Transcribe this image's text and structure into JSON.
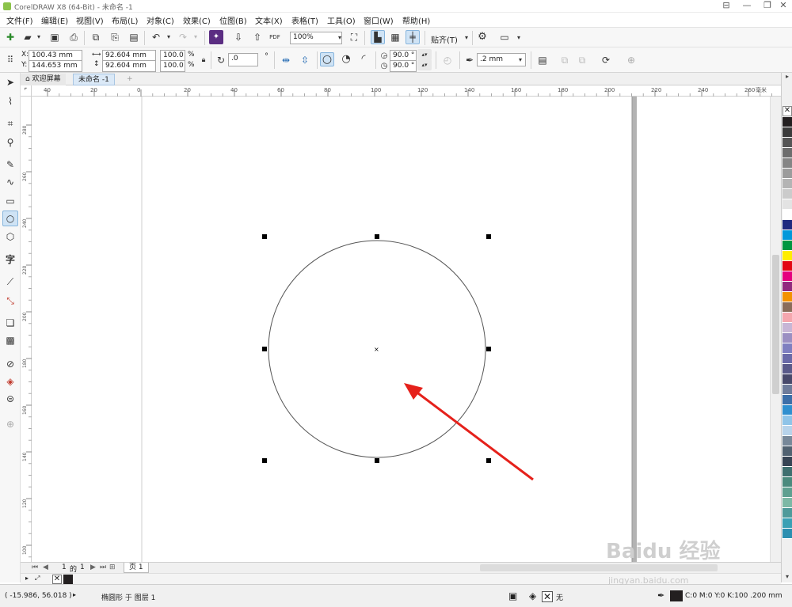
{
  "window": {
    "title": "CorelDRAW X8 (64-Bit) - 未命名 -1",
    "controls": [
      "⊟",
      "—",
      "❐",
      "✕"
    ]
  },
  "menu": [
    "文件(F)",
    "编辑(E)",
    "视图(V)",
    "布局(L)",
    "对象(C)",
    "效果(C)",
    "位图(B)",
    "文本(X)",
    "表格(T)",
    "工具(O)",
    "窗口(W)",
    "帮助(H)"
  ],
  "toolbar": {
    "zoom_value": "100%",
    "snap_label": "贴齐(T)",
    "pdf_label": "PDF"
  },
  "property_bar": {
    "x_label": "X:",
    "x_value": "100.43 mm",
    "y_label": "Y:",
    "y_value": "144.653 mm",
    "width_value": "92.604 mm",
    "height_value": "92.604 mm",
    "scale_x": "100.0",
    "scale_y": "100.0",
    "percent": "%",
    "rotation": ".0",
    "degree": "°",
    "start_angle": "90.0 °",
    "end_angle": "90.0 °",
    "outline_width": ".2 mm"
  },
  "tabs": {
    "welcome": "欢迎屏幕",
    "document": "未命名 -1",
    "add": "+"
  },
  "ruler": {
    "h_ticks": [
      "40",
      "20",
      "0",
      "20",
      "40",
      "60",
      "80",
      "100",
      "120",
      "140",
      "160",
      "180",
      "200",
      "220",
      "240",
      "260"
    ],
    "unit": "毫米",
    "v_ticks": [
      "280",
      "260",
      "240",
      "220",
      "200",
      "180",
      "160",
      "140",
      "120",
      "100",
      "80",
      "60",
      "40"
    ]
  },
  "page_nav": {
    "current": "1",
    "of": "的",
    "total": "1",
    "page_tab": "页 1"
  },
  "status": {
    "cursor_coords": "( -15.986, 56.018 )",
    "object_info": "椭圆形 于 图层 1",
    "fill_label": "无",
    "outline_info": "C:0 M:0 Y:0 K:100  .200 mm"
  },
  "palette_colors": [
    "#231f20",
    "#3b3b3b",
    "#555555",
    "#6d6d6d",
    "#858585",
    "#9c9c9c",
    "#b4b4b4",
    "#cbcbcb",
    "#e3e3e3",
    "#ffffff",
    "#1f2a7f",
    "#0098da",
    "#009640",
    "#ffed00",
    "#e30613",
    "#e5007e",
    "#912a7f",
    "#f39200",
    "#8a6d5a",
    "#f5a7ae",
    "#c7b6d6",
    "#9b8fc2",
    "#7f7fc0",
    "#6a6aa8",
    "#5a5a8a",
    "#48496b",
    "#6e7b9a",
    "#3c6ea8",
    "#2f8fcf",
    "#8fc4e8",
    "#b7d3ea",
    "#778899",
    "#516271",
    "#374454",
    "#3f6f6f",
    "#4b8a7d",
    "#5fa090",
    "#7db8a5",
    "#4f9a9a",
    "#3aa0b4",
    "#2c8fb0"
  ],
  "watermark": {
    "line1": "Baidu 经验",
    "line2": "jingyan.baidu.com"
  }
}
